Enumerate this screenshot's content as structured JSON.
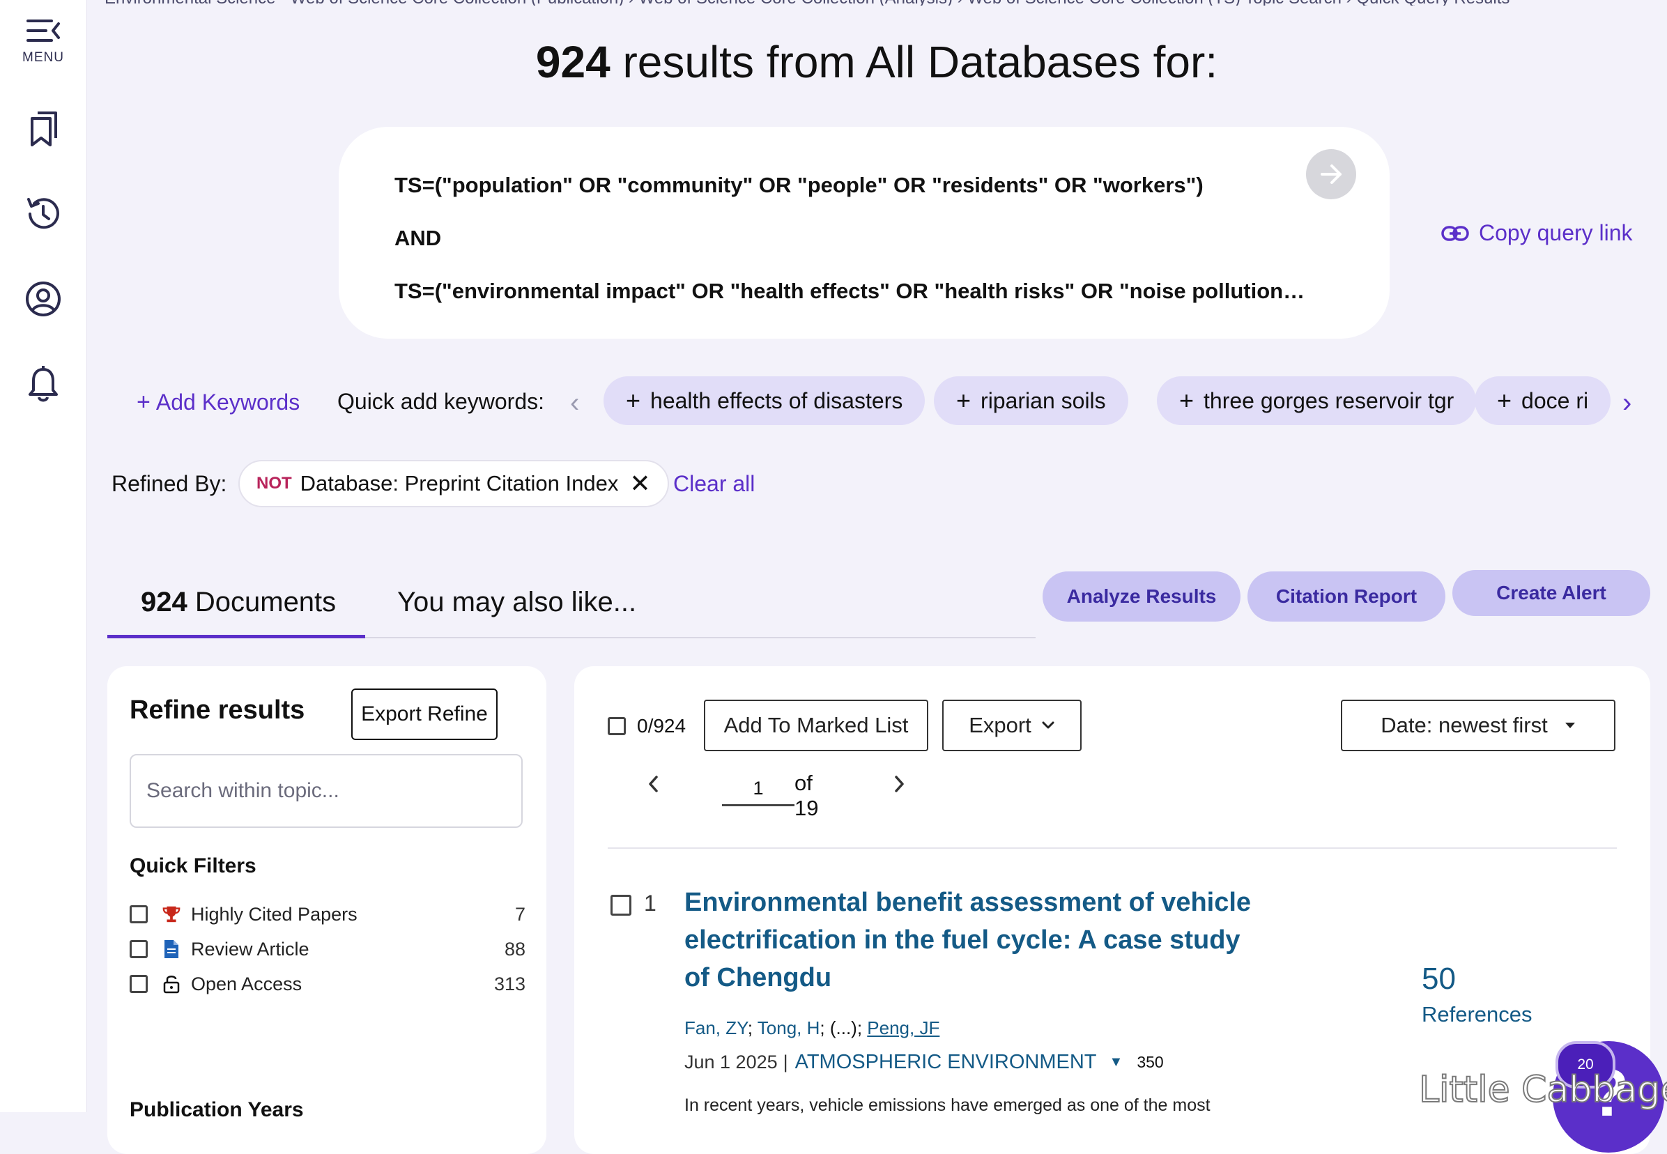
{
  "nav": {
    "menu_label": "MENU",
    "icons": [
      "menu-icon",
      "bookmarks-icon",
      "history-icon",
      "account-icon",
      "notifications-icon"
    ]
  },
  "breadcrumb": "Environmental Science · Web of Science Core Collection (Publication) › Web of Science Core Collection (Analysis) › Web of Science Core Collection (TS) Topic Search › Quick Query Results",
  "header": {
    "result_count": "924",
    "title_suffix": " results from All Databases for:"
  },
  "query": {
    "line1": "TS=(\"population\" OR \"community\" OR \"people\" OR \"residents\" OR \"workers\")",
    "operator": "AND",
    "line3": "TS=(\"environmental impact\" OR \"health effects\" OR \"health risks\" OR \"noise pollution…",
    "copy_link_label": "Copy query link"
  },
  "keywords": {
    "add_label": "Add Keywords",
    "quick_label": "Quick add keywords:",
    "chips": [
      "health effects of disasters",
      "riparian soils",
      "three gorges reservoir tgr",
      "doce ri"
    ]
  },
  "refined": {
    "label": "Refined By:",
    "not_tag": "NOT",
    "filter": "Database: Preprint Citation Index",
    "clear_label": "Clear all"
  },
  "tabs": {
    "documents_count": "924",
    "documents_label": " Documents",
    "also_like_label": "You may also like..."
  },
  "actions": {
    "analyze": "Analyze Results",
    "citation": "Citation Report",
    "alert": "Create Alert"
  },
  "refine_panel": {
    "title": "Refine results",
    "export_label": "Export Refine",
    "search_placeholder": "Search within topic...",
    "quick_filters_title": "Quick Filters",
    "filters": [
      {
        "label": "Highly Cited Papers",
        "count": "7"
      },
      {
        "label": "Review Article",
        "count": "88"
      },
      {
        "label": "Open Access",
        "count": "313"
      }
    ],
    "publication_years": "Publication Years"
  },
  "results": {
    "selected": "0/924",
    "add_marked": "Add To Marked List",
    "export": "Export",
    "sort": "Date: newest first",
    "page": "1",
    "of_pages": "of 19",
    "records": [
      {
        "num": "1",
        "title": "Environmental benefit assessment of vehicle electrification in the fuel cycle: A case study of Chengdu",
        "author1": "Fan, ZY",
        "author2": "Tong, H",
        "ellipsis": "(...)",
        "author3": "Peng, JF",
        "date": "Jun 1 2025",
        "journal": "ATMOSPHERIC ENVIRONMENT",
        "volume": "350",
        "abstract": "In recent years, vehicle emissions have emerged as one of the most",
        "references": "50",
        "references_label": "References"
      }
    ]
  },
  "help": {
    "badge": "20",
    "glyph": "?"
  },
  "watermark": "Little Cabbage",
  "colors": {
    "accent": "#5b2fc9",
    "link": "#145a86",
    "chip_bg": "#e1ddf8",
    "pill_bg": "#c9c4f3",
    "page_bg": "#f3f2fa",
    "not_tag": "#b8245b"
  }
}
